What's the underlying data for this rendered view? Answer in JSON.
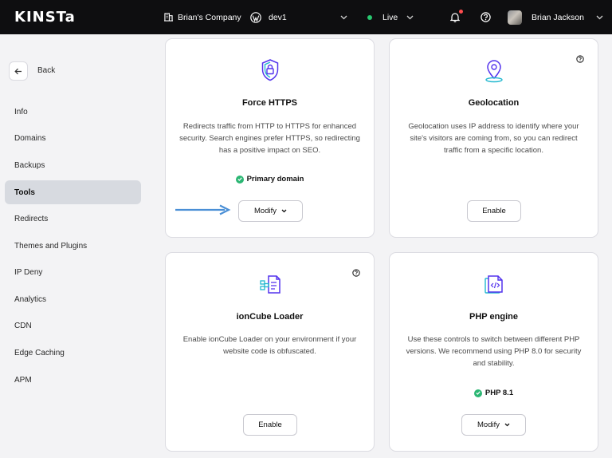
{
  "topbar": {
    "logo": "KINSTa",
    "company": "Brian's Company",
    "site": "dev1",
    "environment": "Live",
    "user": "Brian Jackson",
    "icons": [
      "building-icon",
      "wordpress-icon",
      "bell-icon",
      "help-icon",
      "chevron-down-icon"
    ]
  },
  "sidebar": {
    "back_label": "Back",
    "items": [
      {
        "label": "Info",
        "active": false
      },
      {
        "label": "Domains",
        "active": false
      },
      {
        "label": "Backups",
        "active": false
      },
      {
        "label": "Tools",
        "active": true
      },
      {
        "label": "Redirects",
        "active": false
      },
      {
        "label": "Themes and Plugins",
        "active": false
      },
      {
        "label": "IP Deny",
        "active": false
      },
      {
        "label": "Analytics",
        "active": false
      },
      {
        "label": "CDN",
        "active": false
      },
      {
        "label": "Edge Caching",
        "active": false
      },
      {
        "label": "APM",
        "active": false
      }
    ]
  },
  "cards": {
    "force_https": {
      "title": "Force HTTPS",
      "description": "Redirects traffic from HTTP to HTTPS for enhanced security. Search engines prefer HTTPS, so redirecting has a positive impact on SEO.",
      "status": "Primary domain",
      "button": "Modify",
      "icon": "shield-lock-icon"
    },
    "geolocation": {
      "title": "Geolocation",
      "description": "Geolocation uses IP address to identify where your site's visitors are coming from, so you can redirect traffic from a specific location.",
      "button": "Enable",
      "icon": "map-pin-icon"
    },
    "ioncube": {
      "title": "ionCube Loader",
      "description": "Enable ionCube Loader on your environment if your website code is obfuscated.",
      "button": "Enable",
      "icon": "ioncube-icon"
    },
    "php": {
      "title": "PHP engine",
      "description": "Use these controls to switch between different PHP versions. We recommend using PHP 8.0 for security and stability.",
      "status": "PHP 8.1",
      "button": "Modify",
      "icon": "code-file-icon"
    }
  },
  "colors": {
    "topbar": "#0e0e10",
    "accent_purple": "#5333ed",
    "accent_teal": "#22b8cf",
    "success": "#2bb673",
    "arrow": "#4a8fd6"
  }
}
